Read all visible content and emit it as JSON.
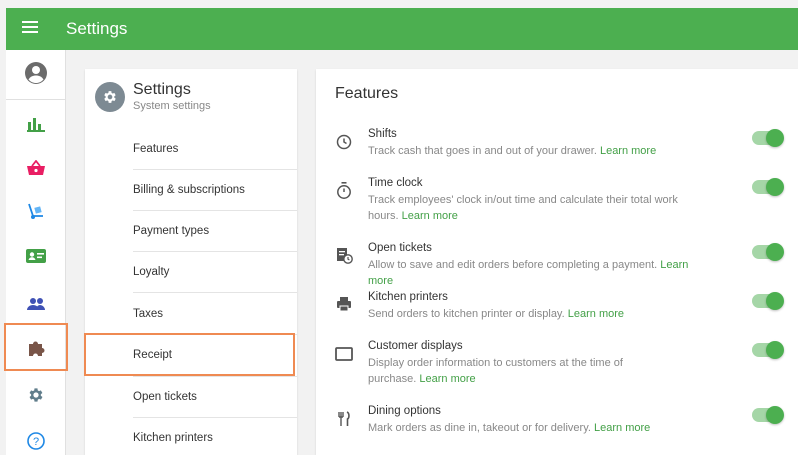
{
  "header": {
    "title": "Settings"
  },
  "rail": {
    "items": [
      {
        "icon": "account-circle-icon",
        "color": "#666666"
      },
      {
        "icon": "bar-chart-icon",
        "color": "#43a047"
      },
      {
        "icon": "basket-icon",
        "color": "#e91e63"
      },
      {
        "icon": "hand-truck-icon",
        "color": "#1e88e5"
      },
      {
        "icon": "id-card-icon",
        "color": "#43a047"
      },
      {
        "icon": "people-icon",
        "color": "#3f51b5"
      },
      {
        "icon": "puzzle-icon",
        "color": "#795548"
      },
      {
        "icon": "gear-icon",
        "color": "#607d8b"
      },
      {
        "icon": "help-icon",
        "color": "#1e88e5"
      }
    ]
  },
  "settings_panel": {
    "title": "Settings",
    "subtitle": "System settings",
    "items": [
      {
        "label": "Features"
      },
      {
        "label": "Billing & subscriptions"
      },
      {
        "label": "Payment types"
      },
      {
        "label": "Loyalty"
      },
      {
        "label": "Taxes"
      },
      {
        "label": "Receipt"
      },
      {
        "label": "Open tickets"
      },
      {
        "label": "Kitchen printers"
      }
    ]
  },
  "main": {
    "title": "Features",
    "learn_more": "Learn more",
    "features": [
      {
        "name": "Shifts",
        "desc": "Track cash that goes in and out of your drawer.",
        "icon": "clock-icon",
        "enabled": true
      },
      {
        "name": "Time clock",
        "desc": "Track employees' clock in/out time and calculate their total work hours.",
        "icon": "stopwatch-icon",
        "enabled": true
      },
      {
        "name": "Open tickets",
        "desc": "Allow to save and edit orders before completing a payment.",
        "icon": "ticket-clock-icon",
        "enabled": true
      },
      {
        "name": "Kitchen printers",
        "desc": "Send orders to kitchen printer or display.",
        "icon": "printer-icon",
        "enabled": true
      },
      {
        "name": "Customer displays",
        "desc": "Display order information to customers at the time of purchase.",
        "icon": "display-icon",
        "enabled": true
      },
      {
        "name": "Dining options",
        "desc": "Mark orders as dine in, takeout or for delivery.",
        "icon": "fork-knife-icon",
        "enabled": true
      }
    ]
  }
}
